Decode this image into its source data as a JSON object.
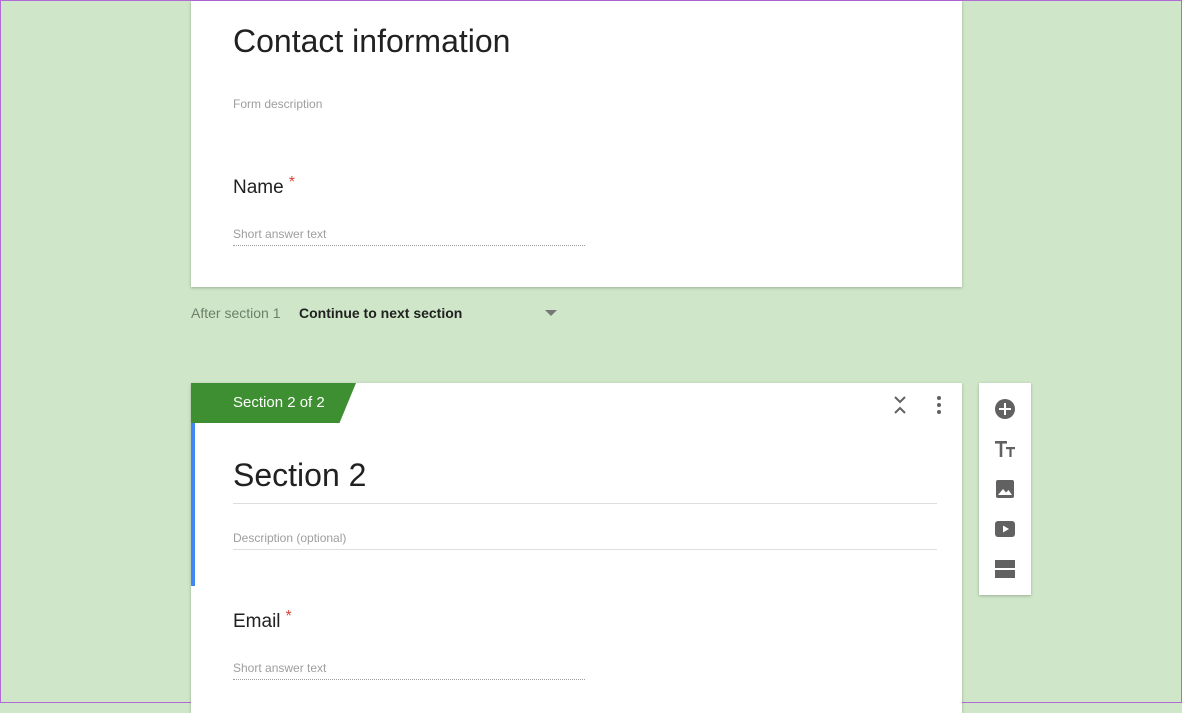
{
  "section1": {
    "title": "Contact information",
    "description_placeholder": "Form description",
    "question": {
      "label": "Name",
      "required_mark": "*",
      "answer_placeholder": "Short answer text"
    }
  },
  "after_section": {
    "label": "After section 1",
    "selected": "Continue to next section"
  },
  "section2": {
    "tab_label": "Section 2 of 2",
    "title": "Section 2",
    "description_placeholder": "Description (optional)",
    "question": {
      "label": "Email",
      "required_mark": "*",
      "answer_placeholder": "Short answer text"
    }
  },
  "toolbar": {
    "icons": [
      "add-question-icon",
      "add-title-icon",
      "add-image-icon",
      "add-video-icon",
      "add-section-icon"
    ]
  },
  "colors": {
    "background": "#cfe7c8",
    "section_tab": "#3d8f31",
    "focus_bar": "#4285f4",
    "required": "#db4437"
  }
}
